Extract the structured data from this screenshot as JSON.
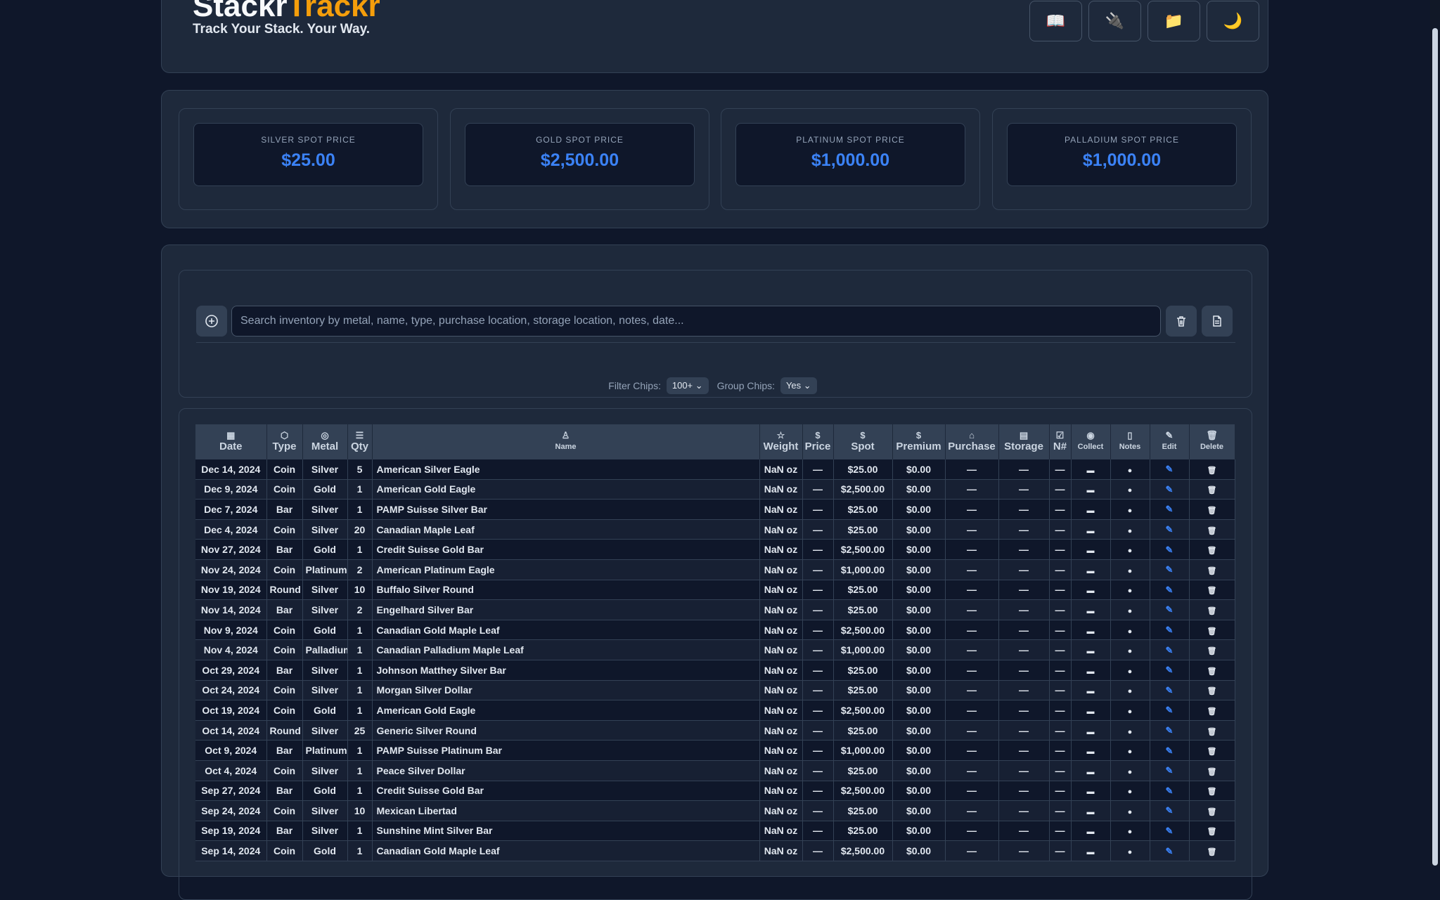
{
  "header": {
    "logo_part1": "Stackr",
    "logo_part2": "Trackr",
    "tagline": "Track Your Stack. Your Way.",
    "buttons": [
      {
        "icon": "book-icon",
        "glyph": "📖"
      },
      {
        "icon": "plug-icon",
        "glyph": "🔌"
      },
      {
        "icon": "folder-icon",
        "glyph": "📁"
      },
      {
        "icon": "moon-icon",
        "glyph": "🌙"
      }
    ]
  },
  "spot_prices": [
    {
      "label": "SILVER SPOT PRICE",
      "value": "$25.00"
    },
    {
      "label": "GOLD SPOT PRICE",
      "value": "$2,500.00"
    },
    {
      "label": "PLATINUM SPOT PRICE",
      "value": "$1,000.00"
    },
    {
      "label": "PALLADIUM SPOT PRICE",
      "value": "$1,000.00"
    }
  ],
  "search": {
    "placeholder": "Search inventory by metal, name, type, purchase location, storage location, notes, date..."
  },
  "chips": {
    "filter_label": "Filter Chips:",
    "filter_value": "100+",
    "group_label": "Group Chips:",
    "group_value": "Yes"
  },
  "table": {
    "headers": {
      "date": "Date",
      "type": "Type",
      "metal": "Metal",
      "qty": "Qty",
      "name": "Name",
      "weight": "Weight",
      "price": "Price",
      "spot": "Spot",
      "premium": "Premium",
      "purchase": "Purchase",
      "storage": "Storage",
      "numismatic": "N#",
      "collect": "Collect",
      "notes": "Notes",
      "edit": "Edit",
      "delete": "Delete"
    },
    "rows": [
      {
        "date": "Dec 14, 2024",
        "type": "Coin",
        "metal": "Silver",
        "qty": "5",
        "name": "American Silver Eagle",
        "weight": "NaN oz",
        "price": "—",
        "spot": "$25.00",
        "premium": "$0.00",
        "purchase": "—",
        "storage": "—",
        "n": "—"
      },
      {
        "date": "Dec 9, 2024",
        "type": "Coin",
        "metal": "Gold",
        "qty": "1",
        "name": "American Gold Eagle",
        "weight": "NaN oz",
        "price": "—",
        "spot": "$2,500.00",
        "premium": "$0.00",
        "purchase": "—",
        "storage": "—",
        "n": "—"
      },
      {
        "date": "Dec 7, 2024",
        "type": "Bar",
        "metal": "Silver",
        "qty": "1",
        "name": "PAMP Suisse Silver Bar",
        "weight": "NaN oz",
        "price": "—",
        "spot": "$25.00",
        "premium": "$0.00",
        "purchase": "—",
        "storage": "—",
        "n": "—"
      },
      {
        "date": "Dec 4, 2024",
        "type": "Coin",
        "metal": "Silver",
        "qty": "20",
        "name": "Canadian Maple Leaf",
        "weight": "NaN oz",
        "price": "—",
        "spot": "$25.00",
        "premium": "$0.00",
        "purchase": "—",
        "storage": "—",
        "n": "—"
      },
      {
        "date": "Nov 27, 2024",
        "type": "Bar",
        "metal": "Gold",
        "qty": "1",
        "name": "Credit Suisse Gold Bar",
        "weight": "NaN oz",
        "price": "—",
        "spot": "$2,500.00",
        "premium": "$0.00",
        "purchase": "—",
        "storage": "—",
        "n": "—"
      },
      {
        "date": "Nov 24, 2024",
        "type": "Coin",
        "metal": "Platinum",
        "qty": "2",
        "name": "American Platinum Eagle",
        "weight": "NaN oz",
        "price": "—",
        "spot": "$1,000.00",
        "premium": "$0.00",
        "purchase": "—",
        "storage": "—",
        "n": "—"
      },
      {
        "date": "Nov 19, 2024",
        "type": "Round",
        "metal": "Silver",
        "qty": "10",
        "name": "Buffalo Silver Round",
        "weight": "NaN oz",
        "price": "—",
        "spot": "$25.00",
        "premium": "$0.00",
        "purchase": "—",
        "storage": "—",
        "n": "—"
      },
      {
        "date": "Nov 14, 2024",
        "type": "Bar",
        "metal": "Silver",
        "qty": "2",
        "name": "Engelhard Silver Bar",
        "weight": "NaN oz",
        "price": "—",
        "spot": "$25.00",
        "premium": "$0.00",
        "purchase": "—",
        "storage": "—",
        "n": "—"
      },
      {
        "date": "Nov 9, 2024",
        "type": "Coin",
        "metal": "Gold",
        "qty": "1",
        "name": "Canadian Gold Maple Leaf",
        "weight": "NaN oz",
        "price": "—",
        "spot": "$2,500.00",
        "premium": "$0.00",
        "purchase": "—",
        "storage": "—",
        "n": "—"
      },
      {
        "date": "Nov 4, 2024",
        "type": "Coin",
        "metal": "Palladium",
        "qty": "1",
        "name": "Canadian Palladium Maple Leaf",
        "weight": "NaN oz",
        "price": "—",
        "spot": "$1,000.00",
        "premium": "$0.00",
        "purchase": "—",
        "storage": "—",
        "n": "—"
      },
      {
        "date": "Oct 29, 2024",
        "type": "Bar",
        "metal": "Silver",
        "qty": "1",
        "name": "Johnson Matthey Silver Bar",
        "weight": "NaN oz",
        "price": "—",
        "spot": "$25.00",
        "premium": "$0.00",
        "purchase": "—",
        "storage": "—",
        "n": "—"
      },
      {
        "date": "Oct 24, 2024",
        "type": "Coin",
        "metal": "Silver",
        "qty": "1",
        "name": "Morgan Silver Dollar",
        "weight": "NaN oz",
        "price": "—",
        "spot": "$25.00",
        "premium": "$0.00",
        "purchase": "—",
        "storage": "—",
        "n": "—"
      },
      {
        "date": "Oct 19, 2024",
        "type": "Coin",
        "metal": "Gold",
        "qty": "1",
        "name": "American Gold Eagle",
        "weight": "NaN oz",
        "price": "—",
        "spot": "$2,500.00",
        "premium": "$0.00",
        "purchase": "—",
        "storage": "—",
        "n": "—"
      },
      {
        "date": "Oct 14, 2024",
        "type": "Round",
        "metal": "Silver",
        "qty": "25",
        "name": "Generic Silver Round",
        "weight": "NaN oz",
        "price": "—",
        "spot": "$25.00",
        "premium": "$0.00",
        "purchase": "—",
        "storage": "—",
        "n": "—"
      },
      {
        "date": "Oct 9, 2024",
        "type": "Bar",
        "metal": "Platinum",
        "qty": "1",
        "name": "PAMP Suisse Platinum Bar",
        "weight": "NaN oz",
        "price": "—",
        "spot": "$1,000.00",
        "premium": "$0.00",
        "purchase": "—",
        "storage": "—",
        "n": "—"
      },
      {
        "date": "Oct 4, 2024",
        "type": "Coin",
        "metal": "Silver",
        "qty": "1",
        "name": "Peace Silver Dollar",
        "weight": "NaN oz",
        "price": "—",
        "spot": "$25.00",
        "premium": "$0.00",
        "purchase": "—",
        "storage": "—",
        "n": "—"
      },
      {
        "date": "Sep 27, 2024",
        "type": "Bar",
        "metal": "Gold",
        "qty": "1",
        "name": "Credit Suisse Gold Bar",
        "weight": "NaN oz",
        "price": "—",
        "spot": "$2,500.00",
        "premium": "$0.00",
        "purchase": "—",
        "storage": "—",
        "n": "—"
      },
      {
        "date": "Sep 24, 2024",
        "type": "Coin",
        "metal": "Silver",
        "qty": "10",
        "name": "Mexican Libertad",
        "weight": "NaN oz",
        "price": "—",
        "spot": "$25.00",
        "premium": "$0.00",
        "purchase": "—",
        "storage": "—",
        "n": "—"
      },
      {
        "date": "Sep 19, 2024",
        "type": "Bar",
        "metal": "Silver",
        "qty": "1",
        "name": "Sunshine Mint Silver Bar",
        "weight": "NaN oz",
        "price": "—",
        "spot": "$25.00",
        "premium": "$0.00",
        "purchase": "—",
        "storage": "—",
        "n": "—"
      },
      {
        "date": "Sep 14, 2024",
        "type": "Coin",
        "metal": "Gold",
        "qty": "1",
        "name": "Canadian Gold Maple Leaf",
        "weight": "NaN oz",
        "price": "—",
        "spot": "$2,500.00",
        "premium": "$0.00",
        "purchase": "—",
        "storage": "—",
        "n": "—"
      }
    ]
  }
}
